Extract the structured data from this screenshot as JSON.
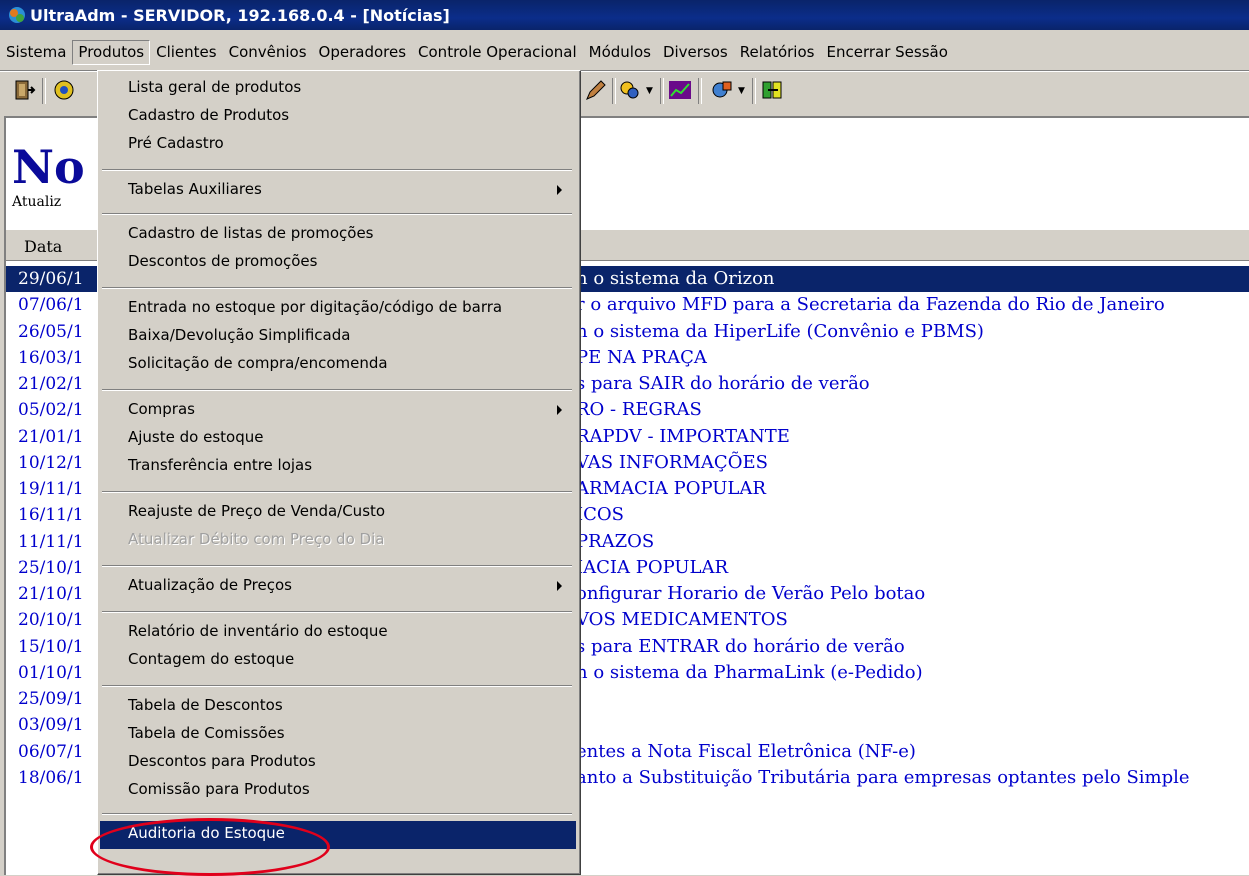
{
  "window": {
    "title": "UltraAdm - SERVIDOR, 192.168.0.4 - [Notícias]"
  },
  "menubar": [
    {
      "label": "Sistema"
    },
    {
      "label": "Produtos",
      "open": true
    },
    {
      "label": "Clientes"
    },
    {
      "label": "Convênios"
    },
    {
      "label": "Operadores"
    },
    {
      "label": "Controle Operacional"
    },
    {
      "label": "Módulos"
    },
    {
      "label": "Diversos"
    },
    {
      "label": "Relatórios"
    },
    {
      "label": "Encerrar Sessão"
    }
  ],
  "page": {
    "title": "No",
    "subtitle": "Atualiz",
    "column_header": "Data"
  },
  "news": [
    {
      "date": "29/06/1",
      "text": "n o sistema da Orizon",
      "selected": true
    },
    {
      "date": "07/06/1",
      "text": "r o arquivo MFD para a Secretaria da Fazenda do Rio de Janeiro"
    },
    {
      "date": "26/05/1",
      "text": "n o sistema da HiperLife (Convênio e PBMS)"
    },
    {
      "date": "16/03/1",
      "text": "PE NA PRAÇA"
    },
    {
      "date": "21/02/1",
      "text": "s para SAIR do horário de verão"
    },
    {
      "date": "05/02/1",
      "text": "RO - REGRAS"
    },
    {
      "date": "21/01/1",
      "text": "RAPDV - IMPORTANTE"
    },
    {
      "date": "10/12/1",
      "text": "VAS INFORMAÇÕES"
    },
    {
      "date": "19/11/1",
      "text": "ARMACIA POPULAR"
    },
    {
      "date": "16/11/1",
      "text": "ICOS"
    },
    {
      "date": "11/11/1",
      "text": "PRAZOS"
    },
    {
      "date": "25/10/1",
      "text": "IACIA POPULAR"
    },
    {
      "date": "21/10/1",
      "text": "onfigurar Horario de Verão Pelo botao"
    },
    {
      "date": "20/10/1",
      "text": "VOS MEDICAMENTOS"
    },
    {
      "date": "15/10/1",
      "text": "s para ENTRAR do horário de verão"
    },
    {
      "date": "01/10/1",
      "text": "n o sistema da PharmaLink (e-Pedido)"
    },
    {
      "date": "25/09/1",
      "text": ""
    },
    {
      "date": "03/09/1",
      "text": ""
    },
    {
      "date": "06/07/1",
      "text": "entes a Nota Fiscal Eletrônica (NF-e)"
    },
    {
      "date": "18/06/1",
      "text": "anto a Substituição Tributária para empresas optantes pelo Simple"
    }
  ],
  "produtos_menu": {
    "items": [
      {
        "label": "Lista geral de produtos"
      },
      {
        "label": "Cadastro de Produtos"
      },
      {
        "label": "Pré Cadastro"
      },
      {
        "label": "Tabelas Auxiliares",
        "submenu": true
      },
      {
        "label": "Cadastro de listas de promoções"
      },
      {
        "label": "Descontos de promoções"
      },
      {
        "label": "Entrada no estoque por digitação/código de barra"
      },
      {
        "label": "Baixa/Devolução Simplificada"
      },
      {
        "label": "Solicitação de compra/encomenda"
      },
      {
        "label": "Compras",
        "submenu": true
      },
      {
        "label": "Ajuste do estoque"
      },
      {
        "label": "Transferência entre lojas"
      },
      {
        "label": "Reajuste de Preço de Venda/Custo"
      },
      {
        "label": "Atualizar Débito com Preço do Dia",
        "disabled": true
      },
      {
        "label": "Atualização de Preços",
        "submenu": true
      },
      {
        "label": "Relatório de inventário do estoque"
      },
      {
        "label": "Contagem do estoque"
      },
      {
        "label": "Tabela de Descontos"
      },
      {
        "label": "Tabela de Comissões"
      },
      {
        "label": "Descontos para Produtos"
      },
      {
        "label": "Comissão para Produtos"
      },
      {
        "label": "Auditoria do Estoque",
        "highlighted": true
      }
    ]
  },
  "colors": {
    "selection": "#0a246a",
    "link": "#0000cc",
    "annotation": "#e0001b"
  }
}
